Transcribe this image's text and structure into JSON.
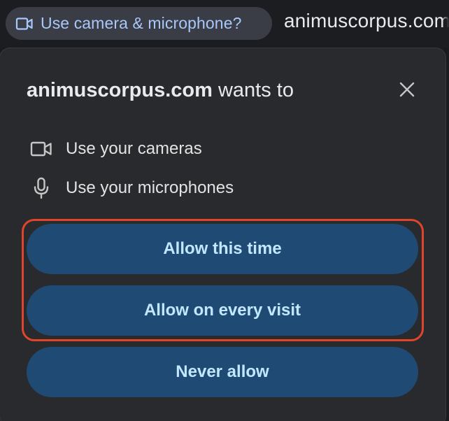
{
  "address_bar": {
    "permission_chip": {
      "label": "Use camera & microphone?",
      "icon": "video-camera-icon"
    },
    "url": "animuscorpus.com"
  },
  "popup": {
    "title_origin": "animuscorpus.com",
    "title_suffix": " wants to",
    "close_icon": "close-icon",
    "permissions": [
      {
        "icon": "video-camera-icon",
        "label": "Use your cameras"
      },
      {
        "icon": "microphone-icon",
        "label": "Use your microphones"
      }
    ],
    "buttons": {
      "allow_once": "Allow this time",
      "allow_always": "Allow on every visit",
      "never_allow": "Never allow"
    }
  },
  "colors": {
    "background": "#292a2d",
    "chip_bg": "#3a3d45",
    "chip_text": "#a8c7fa",
    "button_bg": "#1f4a74",
    "button_text": "#c2e7ff",
    "highlight": "#e0452b"
  }
}
